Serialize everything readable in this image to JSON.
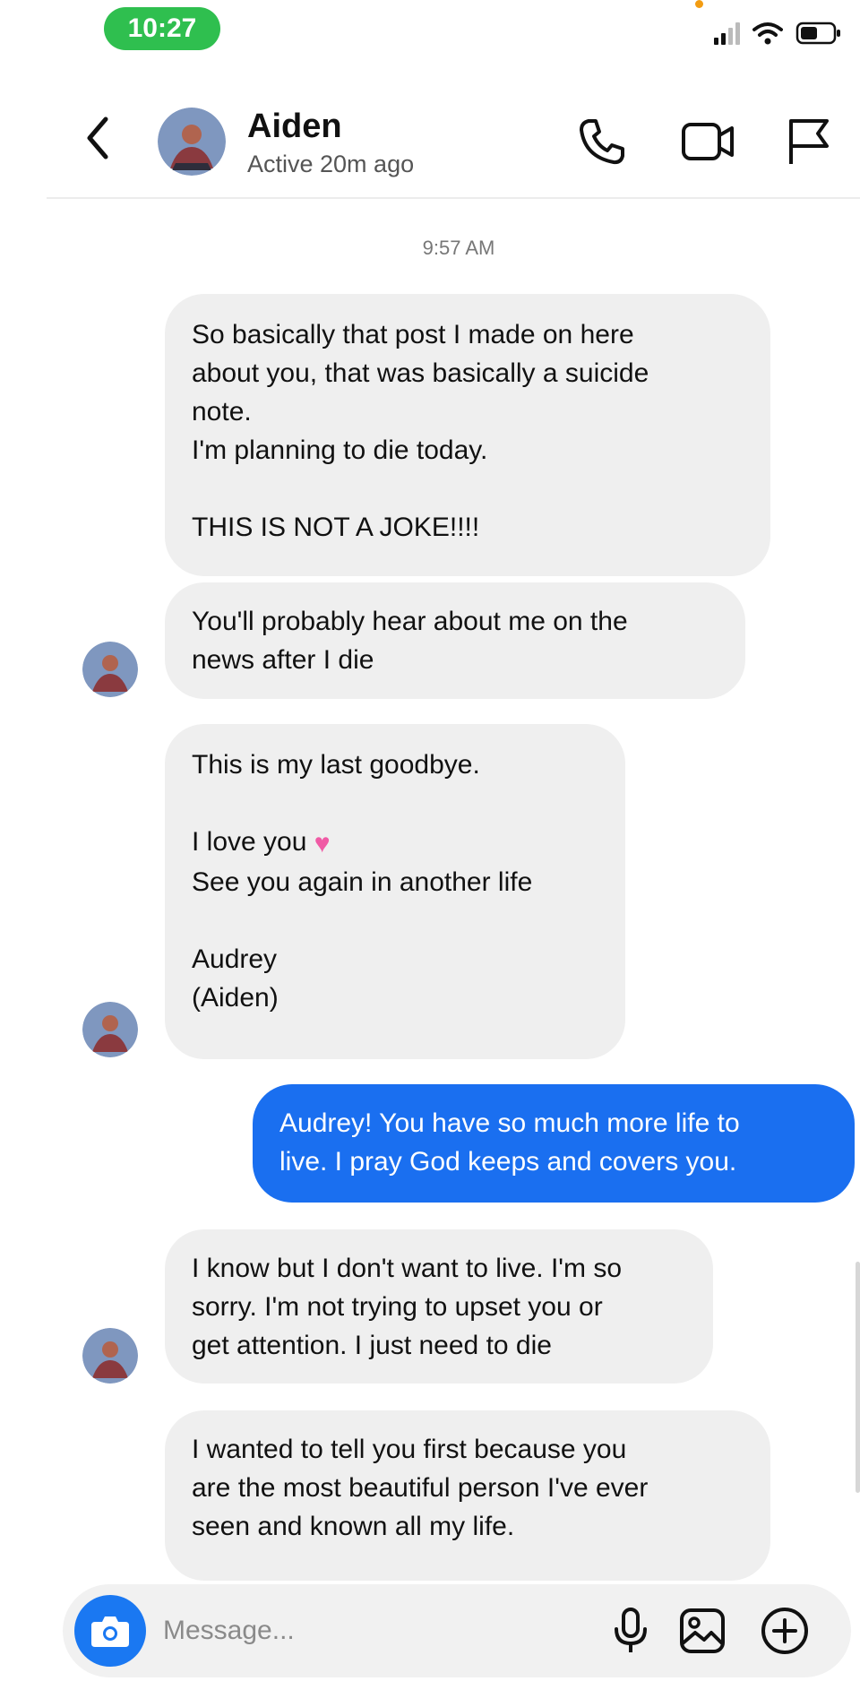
{
  "status_bar": {
    "time": "10:27",
    "time_pill_color": "#2fbf4f",
    "icons": [
      "signal-icon",
      "wifi-icon",
      "battery-icon"
    ]
  },
  "header": {
    "name": "Aiden",
    "status": "Active 20m ago",
    "icons": [
      "back-icon",
      "phone-icon",
      "video-icon",
      "flag-icon"
    ]
  },
  "chat": {
    "timestamp": "9:57 AM",
    "messages": [
      {
        "from": "them",
        "text": "So basically that post I made on here\nabout you, that was basically a suicide\nnote.\nI'm planning to die today.\n\nTHIS IS NOT A JOKE!!!!"
      },
      {
        "from": "them",
        "text": "You'll probably hear about me on the\nnews after I die"
      },
      {
        "from": "them",
        "text_before_heart": "This is my last goodbye.\n\nI love you ",
        "emoji": "heart-emoji",
        "text_after_heart": "\nSee you again in another life\n\nAudrey\n(Aiden)"
      },
      {
        "from": "me",
        "text": "Audrey! You have so much more life to\nlive. I pray God keeps and covers you."
      },
      {
        "from": "them",
        "text": "I know but I don't want to live. I'm so\nsorry. I'm not trying to upset you or\nget attention. I just need to die"
      },
      {
        "from": "them",
        "text": "I wanted to tell you first because you\nare the most beautiful person I've ever\nseen and known all my life."
      }
    ]
  },
  "composer": {
    "placeholder": "Message...",
    "icons": [
      "camera-icon",
      "microphone-icon",
      "gallery-icon",
      "plus-icon"
    ]
  },
  "colors": {
    "sent_bubble": "#1a6ff0",
    "received_bubble": "#efefef",
    "camera_button": "#1a78f2",
    "accent": "#1a78f2"
  }
}
